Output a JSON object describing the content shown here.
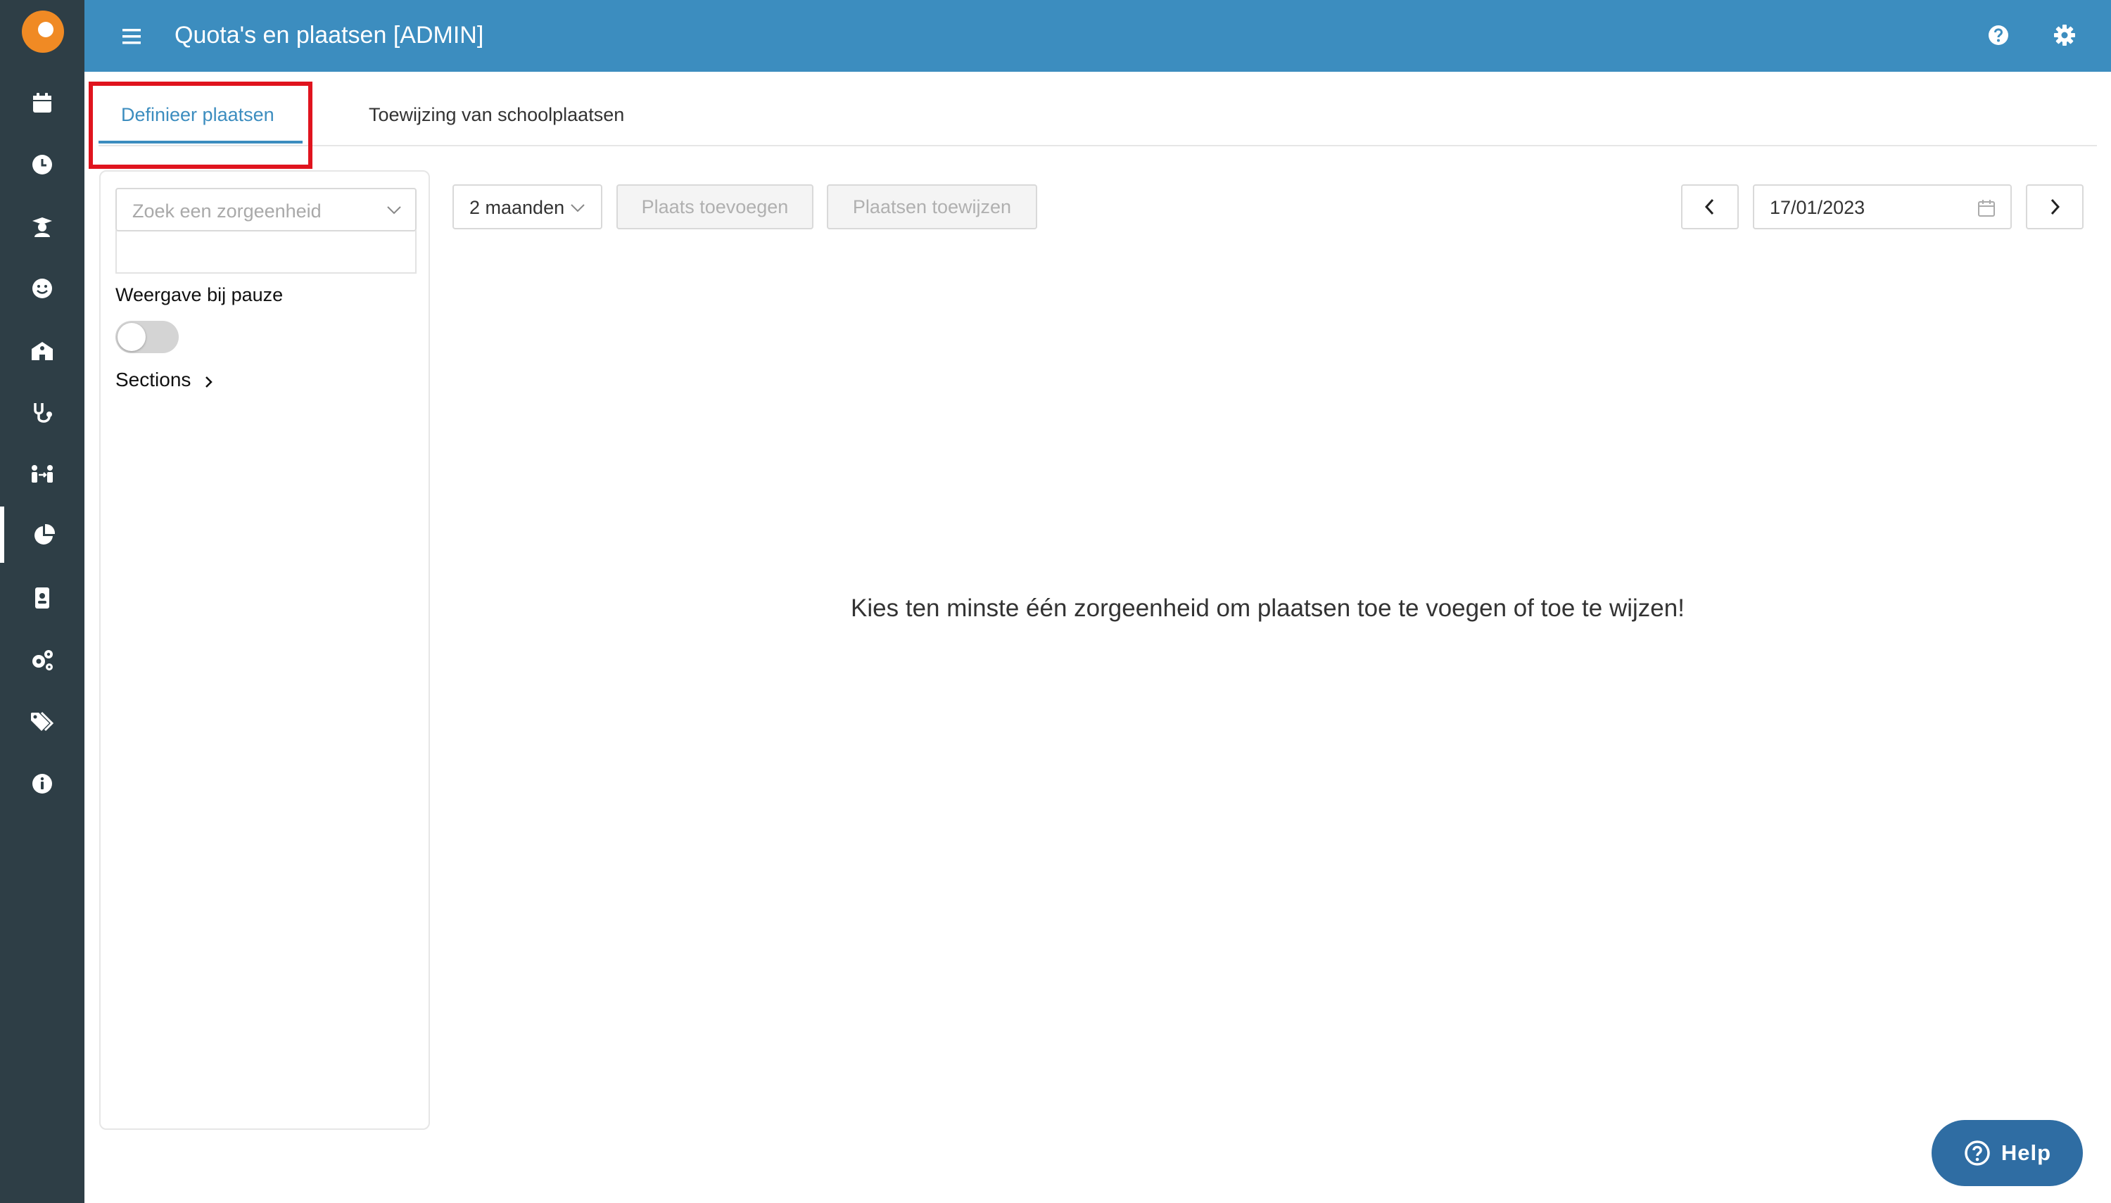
{
  "app": {
    "title": "Quota's en plaatsen [ADMIN]"
  },
  "sidebar": {
    "items": [
      {
        "icon": "calendar-icon"
      },
      {
        "icon": "clock-icon"
      },
      {
        "icon": "graduate-icon"
      },
      {
        "icon": "smiley-icon"
      },
      {
        "icon": "school-icon"
      },
      {
        "icon": "stethoscope-icon"
      },
      {
        "icon": "people-exchange-icon"
      },
      {
        "icon": "pie-chart-icon",
        "active": true
      },
      {
        "icon": "id-badge-icon"
      },
      {
        "icon": "cogs-icon"
      },
      {
        "icon": "tags-icon"
      },
      {
        "icon": "info-icon"
      }
    ]
  },
  "tabs": [
    {
      "label": "Definieer plaatsen",
      "active": true
    },
    {
      "label": "Toewijzing van schoolplaatsen",
      "active": false
    }
  ],
  "filters": {
    "zorgeenheid_placeholder": "Zoek een zorgeenheid",
    "pause_label": "Weergave bij pauze",
    "pause_enabled": false,
    "sections_label": "Sections"
  },
  "toolbar": {
    "period": "2 maanden",
    "add_place_label": "Plaats toevoegen",
    "assign_places_label": "Plaatsen toewijzen",
    "date": "17/01/2023"
  },
  "main": {
    "empty_message": "Kies ten minste één zorgeenheid om plaatsen toe te voegen of toe te wijzen!"
  },
  "help_button": {
    "label": "Help"
  },
  "colors": {
    "topbar": "#3c8dbf",
    "sidebar": "#2e3e46",
    "highlight": "#e0141e",
    "help_button": "#2f6da3"
  }
}
